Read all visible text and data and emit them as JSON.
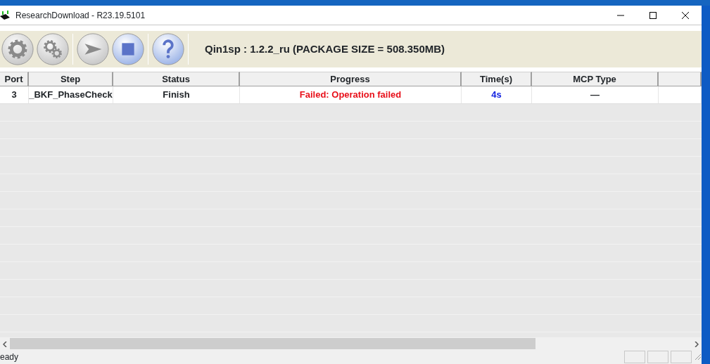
{
  "window": {
    "title": "ResearchDownload - R23.19.5101"
  },
  "toolbar": {
    "buttons": [
      {
        "kind": "gear",
        "disabled": true
      },
      {
        "kind": "gears",
        "disabled": true
      },
      {
        "kind": "play",
        "disabled": true
      },
      {
        "kind": "stop",
        "disabled": false
      },
      {
        "kind": "help",
        "disabled": false
      }
    ],
    "package_info": "Qin1sp : 1.2.2_ru (PACKAGE SIZE = 508.350MB)"
  },
  "table": {
    "columns": [
      "Port",
      "Step",
      "Status",
      "Progress",
      "Time(s)",
      "MCP Type"
    ],
    "rows": [
      {
        "cells": [
          "3",
          "_BKF_PhaseCheck",
          "Finish",
          "Failed: Operation failed",
          "4s",
          "—"
        ],
        "failed": true
      }
    ]
  },
  "status_bar": {
    "text": "eady"
  }
}
